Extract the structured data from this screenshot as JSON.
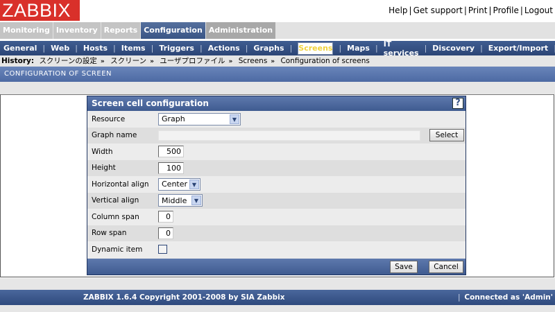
{
  "logo": "ZABBIX",
  "top_links": [
    "Help",
    "Get support",
    "Print",
    "Profile",
    "Logout"
  ],
  "main_tabs": [
    "Monitoring",
    "Inventory",
    "Reports",
    "Configuration",
    "Administration"
  ],
  "active_main_tab": "Configuration",
  "sub_nav": [
    "General",
    "Web",
    "Hosts",
    "Items",
    "Triggers",
    "Actions",
    "Graphs",
    "Screens",
    "Maps",
    "IT services",
    "Discovery",
    "Export/Import"
  ],
  "active_sub_nav": "Screens",
  "history": {
    "label": "History:",
    "items": [
      "スクリーンの設定",
      "スクリーン",
      "ユーザプロファイル",
      "Screens",
      "Configuration of screens"
    ]
  },
  "section_title": "CONFIGURATION OF SCREEN",
  "dialog": {
    "title": "Screen cell configuration",
    "help": "?",
    "fields": {
      "resource": {
        "label": "Resource",
        "value": "Graph"
      },
      "graph_name": {
        "label": "Graph name",
        "value": "",
        "button": "Select"
      },
      "width": {
        "label": "Width",
        "value": "500"
      },
      "height": {
        "label": "Height",
        "value": "100"
      },
      "halign": {
        "label": "Horizontal align",
        "value": "Center"
      },
      "valign": {
        "label": "Vertical align",
        "value": "Middle"
      },
      "colspan": {
        "label": "Column span",
        "value": "0"
      },
      "rowspan": {
        "label": "Row span",
        "value": "0"
      },
      "dynamic": {
        "label": "Dynamic item",
        "checked": false
      }
    },
    "save": "Save",
    "cancel": "Cancel"
  },
  "footer": {
    "copyright": "ZABBIX 1.6.4 Copyright 2001-2008 by  SIA Zabbix",
    "connected": "Connected as 'Admin'"
  },
  "colors": {
    "brand_red": "#d9302a",
    "nav_blue": "#3a5585",
    "active_sub": "#f0d23c"
  }
}
